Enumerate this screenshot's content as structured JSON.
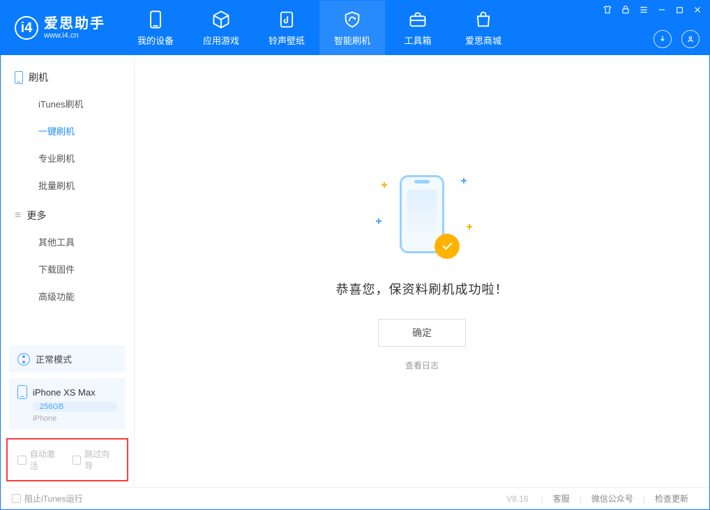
{
  "app": {
    "title": "爱思助手",
    "url": "www.i4.cn"
  },
  "nav": {
    "device": "我的设备",
    "apps": "应用游戏",
    "ring": "铃声壁纸",
    "flash": "智能刷机",
    "tools": "工具箱",
    "store": "爱思商城"
  },
  "sidebar": {
    "flash_head": "刷机",
    "items_flash": {
      "itunes": "iTunes刷机",
      "onekey": "一键刷机",
      "pro": "专业刷机",
      "batch": "批量刷机"
    },
    "more_head": "更多",
    "items_more": {
      "other": "其他工具",
      "firmware": "下载固件",
      "advanced": "高级功能"
    }
  },
  "device": {
    "mode": "正常模式",
    "name": "iPhone XS Max",
    "capacity": "256GB",
    "type": "iPhone"
  },
  "options": {
    "auto_activate": "自动激活",
    "skip_guide": "跳过向导"
  },
  "main": {
    "success_title": "恭喜您，保资料刷机成功啦！",
    "ok": "确定",
    "view_log": "查看日志"
  },
  "status": {
    "block_itunes": "阻止iTunes运行",
    "version": "V8.16",
    "support": "客服",
    "wechat": "微信公众号",
    "update": "检查更新"
  }
}
